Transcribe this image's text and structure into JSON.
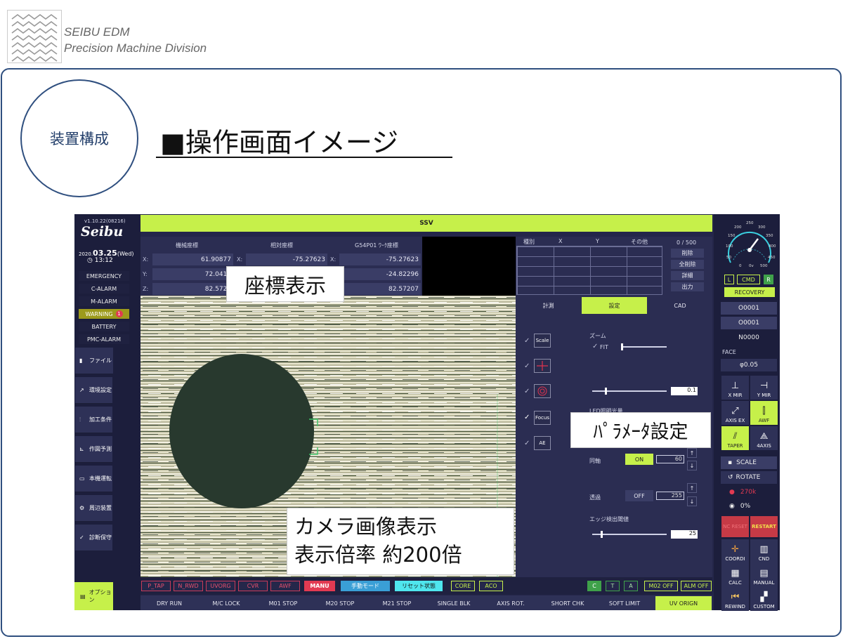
{
  "header": {
    "company": "SEIBU EDM",
    "division": "Precision Machine Division",
    "badge": "装置構成",
    "title": "■操作画面イメージ"
  },
  "screen": {
    "version": "v1.10.22(08216)",
    "logo": "Seibu",
    "date_prefix": "2020.",
    "date": "03.25",
    "weekday": "(Wed)",
    "time": "13:12",
    "alarms": [
      "EMERGENCY",
      "C-ALARM",
      "M-ALARM",
      "WARNING",
      "BATTERY",
      "PMC-ALARM"
    ],
    "warning_count": "1",
    "sidebar": [
      "ファイル",
      "環境設定",
      "加工条件",
      "作図予測",
      "本機運転",
      "周辺装置",
      "診断保守"
    ],
    "option_label": "オプション",
    "top_title": "SSV",
    "coord_headers": [
      "機械座標",
      "相対座標",
      "G54P01 ﾜｰｸ座標"
    ],
    "axes": [
      "X:",
      "Y:",
      "Z:"
    ],
    "machine_coords": [
      "61.90877",
      "72.0410",
      "82.5720"
    ],
    "relative_coords": [
      "-75.27623",
      "",
      ""
    ],
    "work_coords": [
      "-75.27623",
      "-24.82296",
      "82.57207"
    ],
    "list_headers": [
      "種別",
      "X",
      "Y",
      "その他"
    ],
    "list_count": "0 / 500",
    "list_buttons": [
      "削除",
      "全削除",
      "詳細",
      "出力"
    ],
    "tabs": [
      "計測",
      "設定",
      "CAD"
    ],
    "settings": {
      "zoom_label": "ズーム",
      "fit_label": "FIT",
      "scale_label": "Scale",
      "focus_label": "Focus",
      "ae_label": "AE",
      "value1": "0.1",
      "led_label": "LED照明光量",
      "coaxial_label": "同軸",
      "coaxial_state": "ON",
      "coaxial_value": "60",
      "transmit_label": "透過",
      "transmit_state": "OFF",
      "transmit_value": "255",
      "edge_label": "エッジ検出閾値",
      "edge_value": "25"
    },
    "status_tags": [
      "P_TAP",
      "N_RWD",
      "UVORG",
      "CVR",
      "AWF",
      "MANU"
    ],
    "mode_buttons": [
      "手動モード",
      "リセット状態"
    ],
    "core_labels": [
      "CORE",
      "ACO"
    ],
    "cta_labels": [
      "C",
      "T",
      "A"
    ],
    "m_labels": [
      "M02 OFF",
      "ALM OFF"
    ],
    "func_keys": [
      "DRY RUN",
      "M/C LOCK",
      "M01 STOP",
      "M20 STOP",
      "M21 STOP",
      "SINGLE BLK",
      "AXIS ROT.",
      "SHORT CHK",
      "SOFT LIMIT",
      "UV ORIGN"
    ],
    "gauge": {
      "ticks": [
        "0",
        "50",
        "100",
        "150",
        "200",
        "250",
        "300",
        "350",
        "400",
        "450",
        "500"
      ],
      "unit": "0v",
      "value": 0
    },
    "lcr": [
      "L",
      "CMD",
      "R"
    ],
    "recovery": "RECOVERY",
    "program_numbers": [
      "O0001",
      "O0001",
      "N0000"
    ],
    "face_label": "FACE",
    "phi_label": "φ0.05",
    "icon_buttons": [
      "X MIR",
      "Y MIR",
      "AXIS EX",
      "AWF",
      "TAPER",
      "4AXIS"
    ],
    "scale_btn": "SCALE",
    "rotate_btn": "ROTATE",
    "red_value": "270k",
    "percent": "0%",
    "reset_btn": "NC RESET",
    "restart_btn": "RESTART",
    "bottom_icons": [
      "COORDI",
      "CND",
      "CALC",
      "MANUAL",
      "REWIND",
      "CUSTOM"
    ]
  },
  "callouts": {
    "coords": "座標表示",
    "params": "ﾊﾟﾗﾒｰﾀ設定",
    "camera_line1": "カメラ画像表示",
    "camera_line2": "表示倍率 約200倍"
  },
  "colors": {
    "frame": "#2f4f7f",
    "screen_bg": "#24264a",
    "accent_green": "#c6f04a",
    "alarm_red": "#e23a52"
  }
}
